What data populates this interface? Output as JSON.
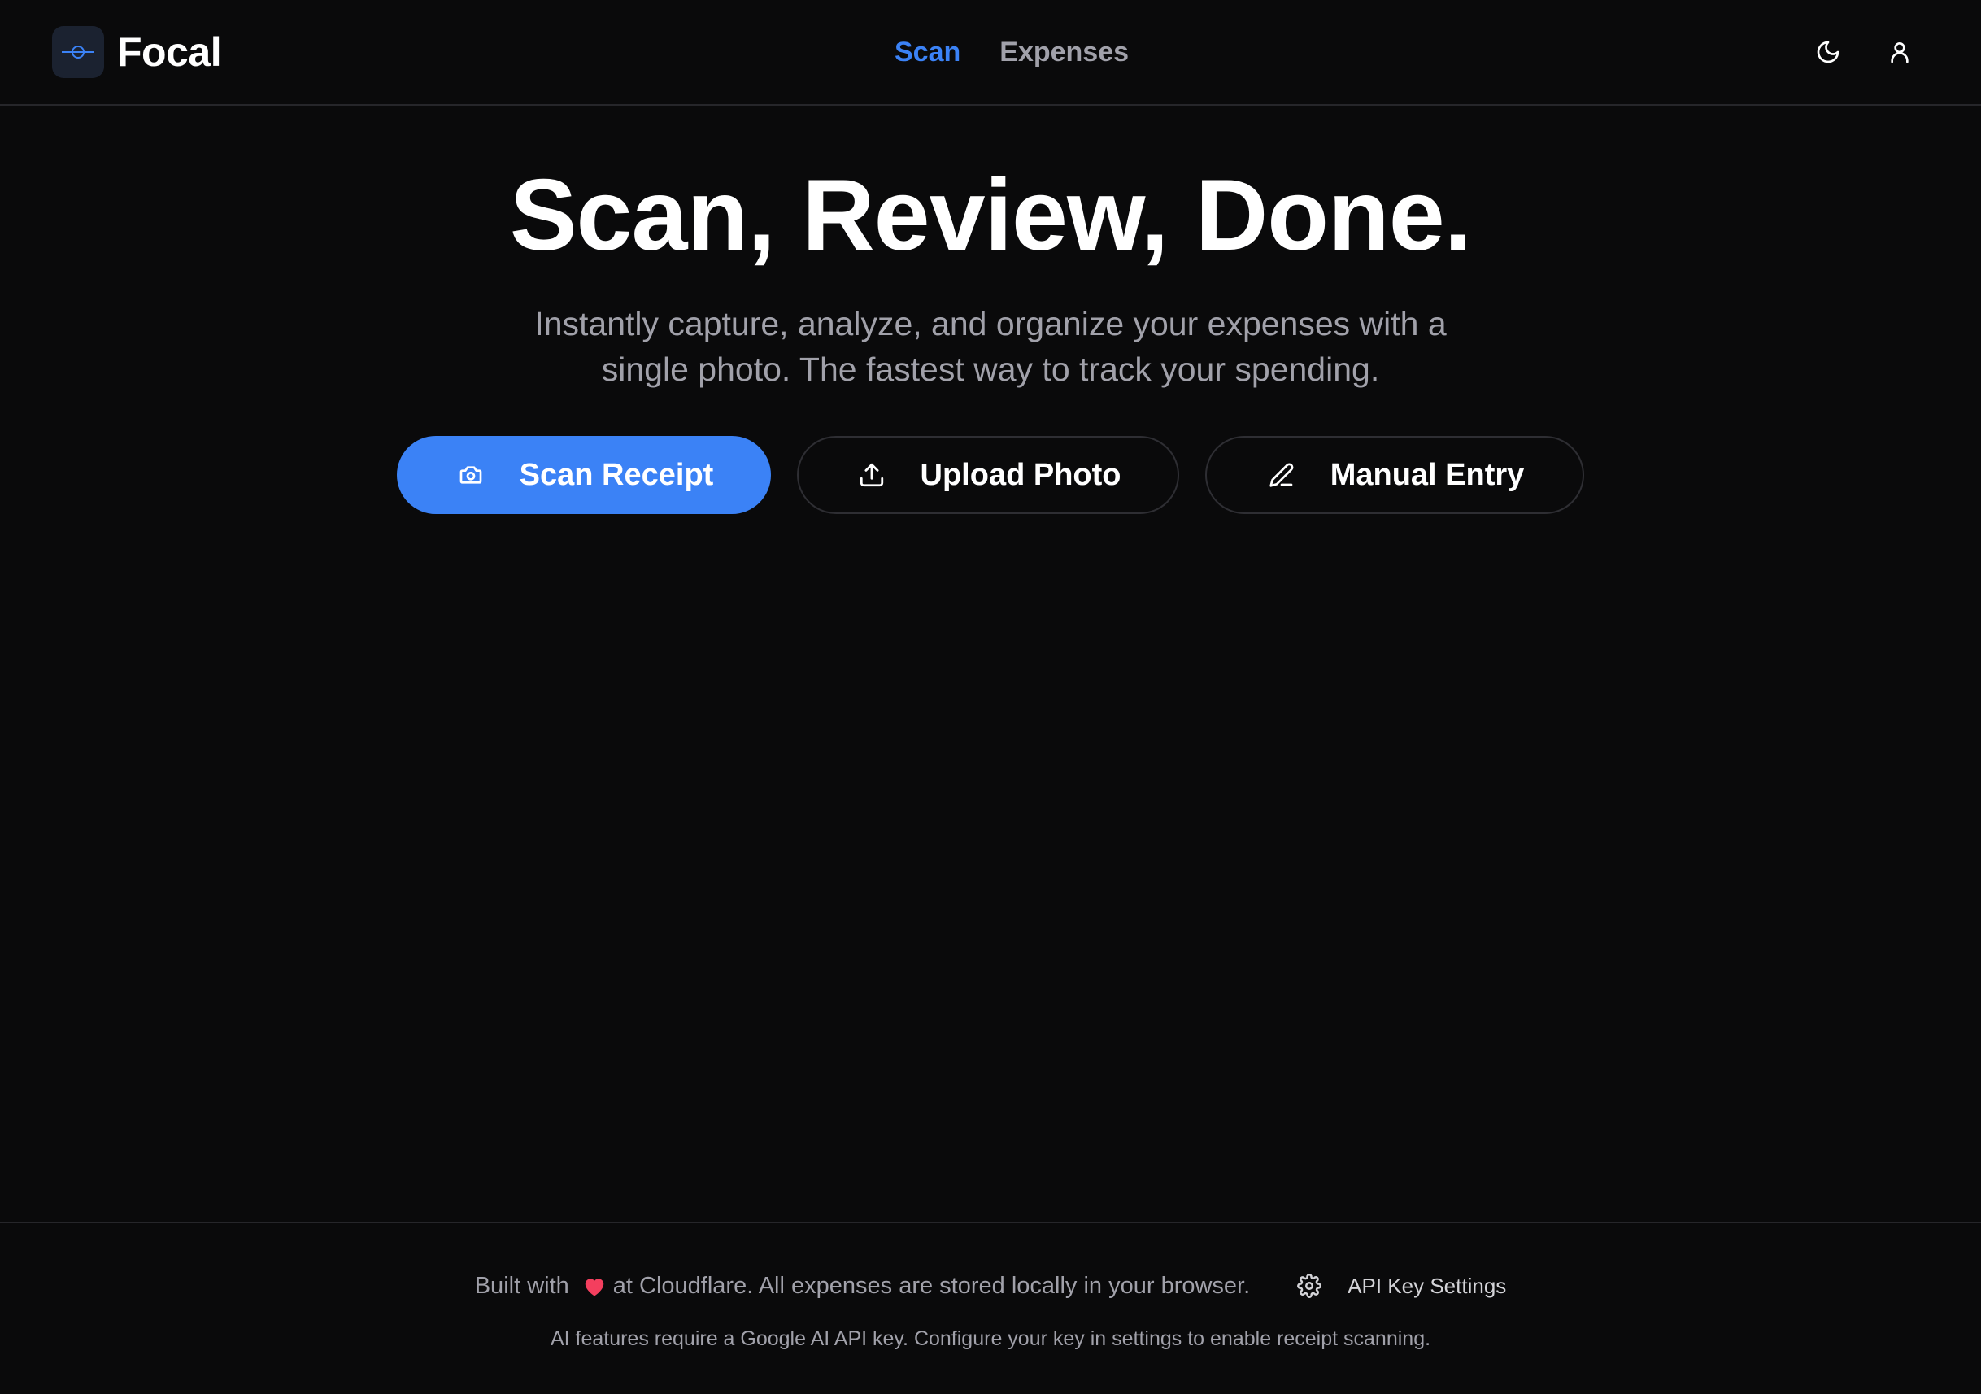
{
  "app": {
    "name": "Focal"
  },
  "nav": {
    "items": [
      {
        "label": "Scan",
        "active": true
      },
      {
        "label": "Expenses",
        "active": false
      }
    ]
  },
  "header_icons": [
    "moon-icon",
    "user-icon"
  ],
  "hero": {
    "title": "Scan, Review, Done.",
    "subtitle_line1": "Instantly capture, analyze, and organize your expenses with a",
    "subtitle_line2": "single photo. The fastest way to track your spending."
  },
  "actions": {
    "scan_receipt": "Scan Receipt",
    "upload_photo": "Upload Photo",
    "manual_entry": "Manual Entry"
  },
  "footer": {
    "built_with": "Built with",
    "built_rest": "at Cloudflare. All expenses are stored locally in your browser.",
    "settings_label": "API Key Settings",
    "ai_notice": "AI features require a Google AI API key. Configure your key in settings to enable receipt scanning."
  },
  "colors": {
    "accent": "#3b82f6",
    "background": "#0a0a0b",
    "muted_text": "#a1a1aa",
    "heart": "#f43f5e"
  }
}
